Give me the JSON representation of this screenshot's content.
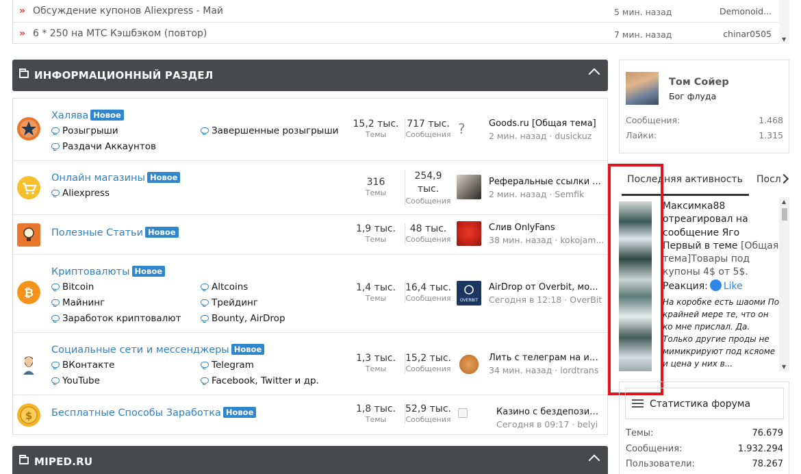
{
  "recent_threads": [
    {
      "title": "Обсуждение купонов Aliexpress - Май",
      "time": "5 мин. назад",
      "user": "Demonoid..."
    },
    {
      "title": "6 * 250 на МТС Кэшбэком (повтор)",
      "time": "7 мин. назад",
      "user": "chinar0505"
    }
  ],
  "categories": [
    {
      "title": "ИНФОРМАЦИОННЫЙ РАЗДЕЛ"
    },
    {
      "title": "MIPED.RU"
    }
  ],
  "forums": [
    {
      "title": "Халява",
      "badge": "Новое",
      "icon_color": "#e8762d",
      "icon": "star-icon",
      "subforums": [
        "Розыгрыши",
        "Завершенные розыгрыши",
        "Раздачи Аккаунтов"
      ],
      "threads": "15,2 тыс.",
      "threads_label": "Темы",
      "messages": "717 тыс.",
      "messages_label": "Сообщения",
      "last_title": "Goods.ru [Общая тема]",
      "last_meta": "2 мин. назад · dusickuz"
    },
    {
      "title": "Онлайн магазины",
      "badge": "Новое",
      "icon_color": "#f5c02b",
      "icon": "cart-icon",
      "subforums": [
        "Aliexpress"
      ],
      "threads": "316",
      "threads_label": "Темы",
      "messages": "254,9 тыс.",
      "messages_label": "Сообщения",
      "last_title": "Реферальные ссылки ...",
      "last_meta": "2 мин. назад · Semfik"
    },
    {
      "title": "Полезные Статьи",
      "badge": "Новое",
      "icon_color": "#e8762d",
      "icon": "lightbulb-icon",
      "subforums": [],
      "threads": "1,9 тыс.",
      "threads_label": "Темы",
      "messages": "48 тыс.",
      "messages_label": "Сообщения",
      "last_title": "Слив OnlyFans",
      "last_meta": "38 мин. назад · kokojam..."
    },
    {
      "title": "Криптовалюты",
      "badge": "Новое",
      "icon_color": "#f4931a",
      "icon": "bitcoin-icon",
      "subforums": [
        "Bitcoin",
        "Altcoins",
        "Майнинг",
        "Трейдинг",
        "Заработок криптовалют",
        "Bounty, AirDrop"
      ],
      "threads": "1,4 тыс.",
      "threads_label": "Темы",
      "messages": "16,4 тыс.",
      "messages_label": "Сообщения",
      "last_title": "AirDrop от Overbit, мо...",
      "last_meta": "Сегодня в 12:18 · OverBit"
    },
    {
      "title": "Социальные сети и мессенджеры",
      "badge": "Новое",
      "icon_color": "#ffffff",
      "icon": "bearded-man-icon",
      "subforums": [
        "ВКонтакте",
        "Telegram",
        "YouTube",
        "Facebook, Twitter и др."
      ],
      "threads": "1,3 тыс.",
      "threads_label": "Темы",
      "messages": "15,2 тыс.",
      "messages_label": "Сообщения",
      "last_title": "Лить с телеграм на ин...",
      "last_meta": "34 мин. назад · lordtrans"
    },
    {
      "title": "Бесплатные Способы Заработка",
      "badge": "Новое",
      "icon_color": "#f4b42a",
      "icon": "dollar-coin-icon",
      "subforums": [],
      "threads": "1,8 тыс.",
      "threads_label": "Темы",
      "messages": "52,9 тыс.",
      "messages_label": "Сообщения",
      "last_title": "Казино с бездепозит...",
      "last_meta": "Сегодня в 09:17 · belyi"
    }
  ],
  "user_card": {
    "name": "Том Сойер",
    "role": "Бог флуда",
    "messages_label": "Сообщения:",
    "messages": "1.468",
    "likes_label": "Лайки:",
    "likes": "1.315"
  },
  "tabs": {
    "active": "Последняя активность",
    "next": "Посл"
  },
  "activity": {
    "text_line": "Максимка88 отреагировал на сообщение Яго Первый в теме ",
    "link": "[Общая тема]Товары под купоны 4$ от 5$.",
    "reaction_label": "Реакция:",
    "reaction": "Like",
    "quote": "На коробке есть шаоми По крайней мере те, что он ко мне прислал. Да. Только другие проды не мимикрируют под ксяоме и цена у них в..."
  },
  "forum_stats": {
    "title": "Статистика форума",
    "threads_label": "Темы:",
    "threads": "76.679",
    "messages_label": "Сообщения:",
    "messages": "1.932.294",
    "users_label": "Пользователи:",
    "users": "78.267"
  },
  "colors": {
    "link": "#2f7fc1",
    "badge": "#2f86cc",
    "header": "#47494c",
    "highlight": "#e4141c",
    "arrow": "#e03a2d"
  }
}
